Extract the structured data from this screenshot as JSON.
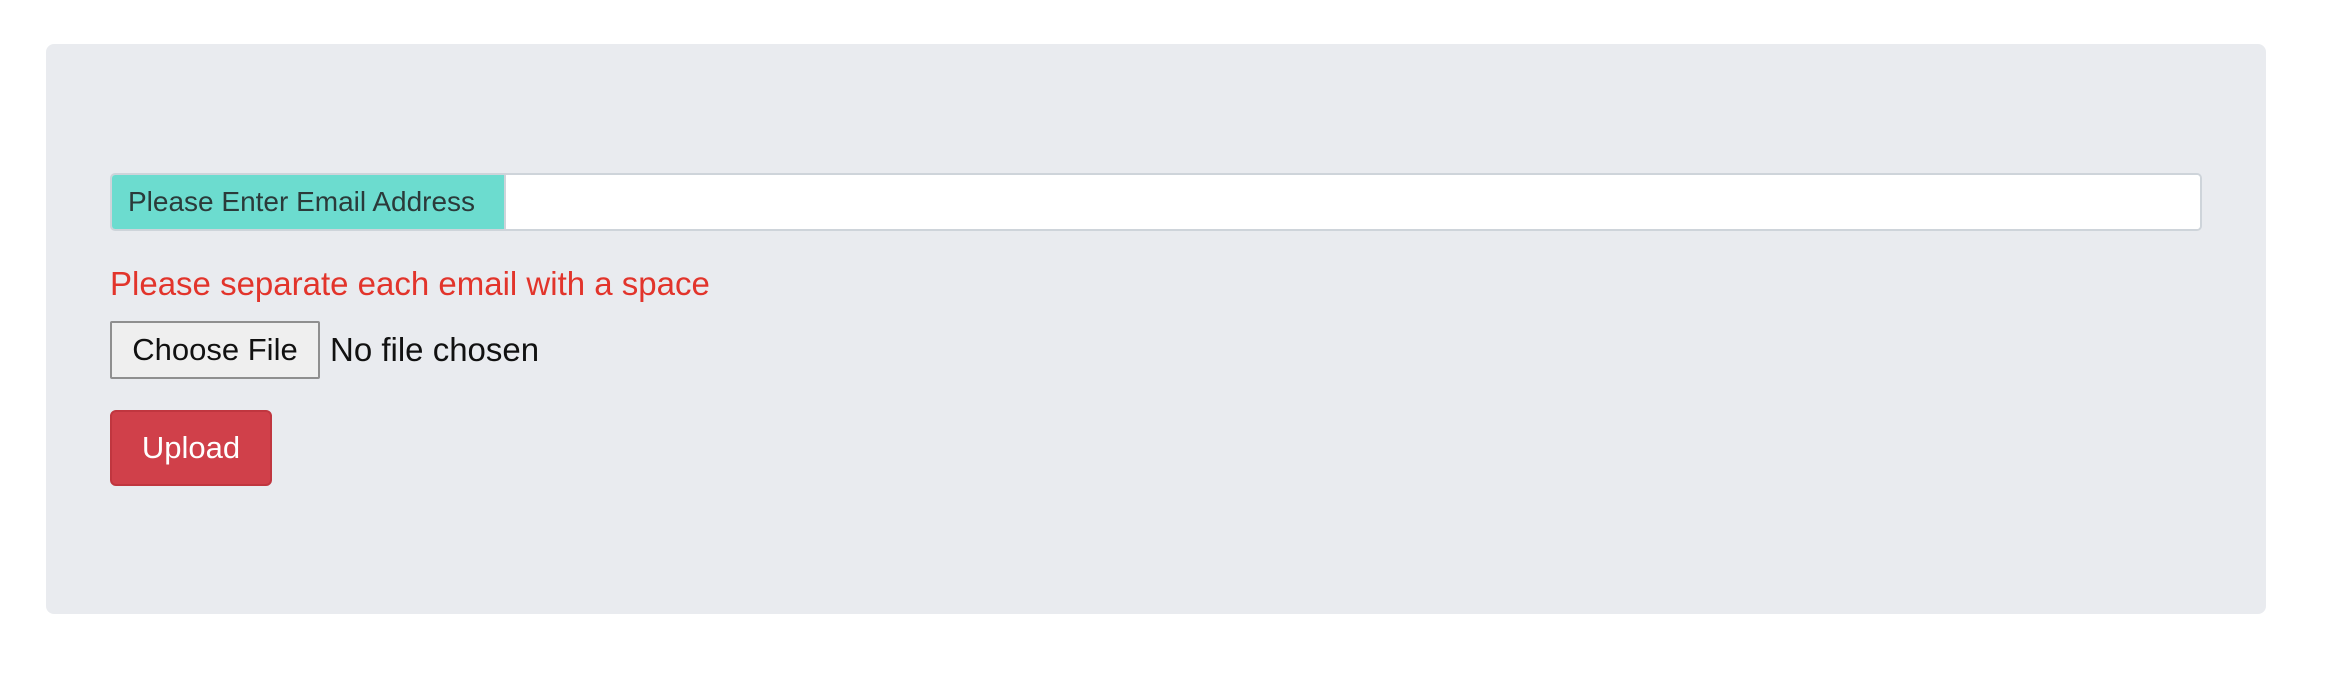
{
  "form": {
    "email_label": "Please Enter Email Address",
    "email_value": "",
    "hint": "Please separate each email with a space",
    "file_button_label": "Choose File",
    "file_status": "No file chosen",
    "upload_label": "Upload"
  },
  "colors": {
    "panel_background": "#e9ebef",
    "label_background": "#6cdccf",
    "hint_text": "#e2342b",
    "upload_button": "#d0404a"
  }
}
